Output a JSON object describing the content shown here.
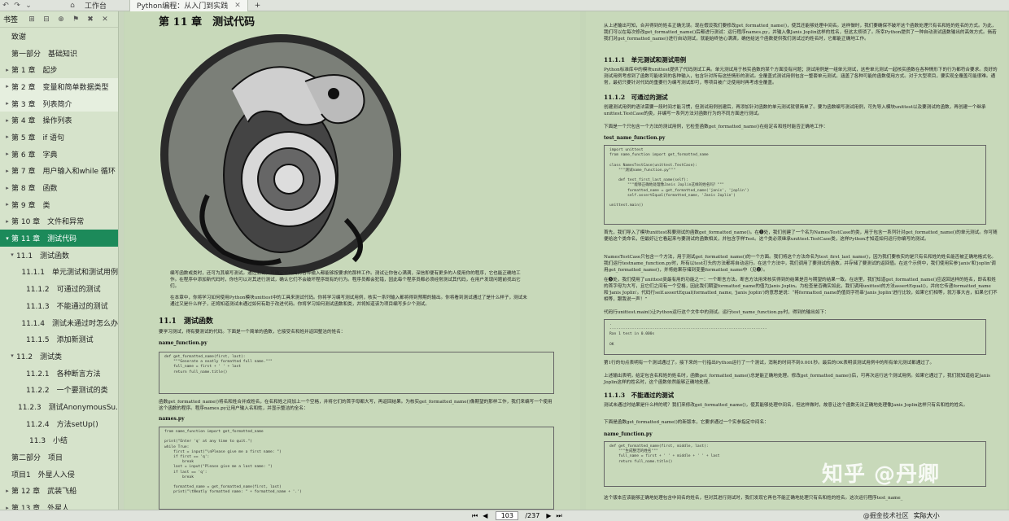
{
  "topbar": {
    "workspace_label": "工作台",
    "tab_title": "Python编程：从入门到实践",
    "add_tab": "+"
  },
  "sidebar": {
    "title": "书签",
    "items": [
      {
        "label": "致谢",
        "level": 0,
        "arrow": ""
      },
      {
        "label": "第一部分　基础知识",
        "level": 0,
        "arrow": ""
      },
      {
        "label": "第 1 章　起步",
        "level": 0,
        "arrow": "▸"
      },
      {
        "label": "第 2 章　变量和简单数据类型",
        "level": 0,
        "arrow": "▸"
      },
      {
        "label": "第 3 章　列表简介",
        "level": 0,
        "arrow": "▸"
      },
      {
        "label": "第 4 章　操作列表",
        "level": 0,
        "arrow": "▸"
      },
      {
        "label": "第 5 章　if 语句",
        "level": 0,
        "arrow": "▸"
      },
      {
        "label": "第 6 章　字典",
        "level": 0,
        "arrow": "▸"
      },
      {
        "label": "第 7 章　用户输入和while 循环",
        "level": 0,
        "arrow": "▸"
      },
      {
        "label": "第 8 章　函数",
        "level": 0,
        "arrow": "▸"
      },
      {
        "label": "第 9 章　类",
        "level": 0,
        "arrow": "▸"
      },
      {
        "label": "第 10 章　文件和异常",
        "level": 0,
        "arrow": "▸"
      },
      {
        "label": "第 11 章　测试代码",
        "level": 0,
        "arrow": "▾"
      },
      {
        "label": "11.1　测试函数",
        "level": 1,
        "arrow": "▾"
      },
      {
        "label": "11.1.1　单元测试和测试用例",
        "level": 2,
        "arrow": ""
      },
      {
        "label": "11.1.2　可通过的测试",
        "level": 2,
        "arrow": ""
      },
      {
        "label": "11.1.3　不能通过的测试",
        "level": 2,
        "arrow": ""
      },
      {
        "label": "11.1.4　测试未通过时怎么办",
        "level": 2,
        "arrow": ""
      },
      {
        "label": "11.1.5　添加新测试",
        "level": 2,
        "arrow": ""
      },
      {
        "label": "11.2　测试类",
        "level": 1,
        "arrow": "▾"
      },
      {
        "label": "11.2.1　各种断言方法",
        "level": 2,
        "arrow": ""
      },
      {
        "label": "11.2.2　一个要测试的类",
        "level": 2,
        "arrow": ""
      },
      {
        "label": "11.2.3　测试AnonymousSu...",
        "level": 2,
        "arrow": ""
      },
      {
        "label": "11.2.4　方法setUp()",
        "level": 2,
        "arrow": ""
      },
      {
        "label": "11.3　小结",
        "level": 3,
        "arrow": ""
      },
      {
        "label": "第二部分　项目",
        "level": 0,
        "arrow": ""
      },
      {
        "label": "项目1　外星人入侵",
        "level": 0,
        "arrow": ""
      },
      {
        "label": "第 12 章　武装飞船",
        "level": 0,
        "arrow": "▸"
      },
      {
        "label": "第 13 章　外星人",
        "level": 0,
        "arrow": "▸"
      }
    ]
  },
  "page_left": {
    "chapter_title": "第 11 章　测试代码",
    "intro_p1": "编写函数或类时，还可为其编写测试。通过测试，可确定代码面对各种输入都能够按要求的那样工作。测试让你信心满满，深信即便有更多的人使用你的程序，它也能正确地工作。在程序中添加新代码时，你也可以对其进行测试，确认它们不会破坏程序既有的行为。程序员都会犯错，因此每个程序员都必须经常测试其代码，在用户发现问题前找出它们。",
    "intro_p2": "在本章中，你将学习如何使用Python模块unittest中的工具来测试代码。你将学习编写测试用例，核实一系列输入都将得到预期的输出。你将看到测试通过了是什么样子，测试未通过又是什么样子，还将知道测试未通过如何有助于改进代码。你将学习如何测试函数和类，并将知道该为项目编写多少个测试。",
    "sec_title": "11.1　测试函数",
    "sec_text": "要学习测试，得有要测试的代码。下面是一个简单的函数，它接受名和姓并返回整洁的姓名：",
    "file1": "name_function.py",
    "code1": "def get_formatted_name(first, last):\n    \"\"\"Generate a neatly formatted full name.\"\"\"\n    full_name = first + ' ' + last\n    return full_name.title()",
    "para3": "函数get_formatted_name()将名和姓合并成姓名，在名和姓之间加上一个空格，并将它们的首字母都大写，再返回结果。为核实get_formatted_name()像期望的那样工作，我们来编写一个使用这个函数的程序。程序names.py让用户输入名和姓，并显示整洁的全名：",
    "file2": "names.py",
    "code2": "from name_function import get_formatted_name\n\nprint(\"Enter 'q' at any time to quit.\")\nwhile True:\n    first = input(\"\\nPlease give me a first name: \")\n    if first == 'q':\n        break\n    last = input(\"Please give me a last name: \")\n    if last == 'q':\n        break\n\n    formatted_name = get_formatted_name(first, last)\n    print(\"\\tNeatly formatted name: \" + formatted_name + '.')"
  },
  "page_right": {
    "p_top": "从上述输出可知，合并得到的姓名正确无误。现在假设我们要修改get_formatted_name()，使其还能够处理中间名。这样做时，我们要确保不破坏这个函数处理只有名和姓的姓名的方式。为此，我们可以在每次修改get_formatted_name()后都进行测试：运行程序names.py，并输入像Janis Joplin这样的姓名，但这太烦琐了。所幸Python提供了一种自动测试函数输出的高效方式。倘若我们对get_formatted_name()进行自动测试，就能始终信心满满，确信给这个函数提供我们测试过的姓名时，它都能正确地工作。",
    "h_1111": "11.1.1　单元测试和测试用例",
    "p_1111": "Python标准库中的模块unittest提供了代码测试工具。单元测试用于核实函数的某个方面没有问题；测试用例是一组单元测试，这些单元测试一起核实函数在各种情形下的行为都符合要求。良好的测试用例考虑到了函数可能收到的各种输入，包含针对所有这些情形的测试。全覆盖式测试用例包含一整套单元测试，涵盖了各种可能的函数使用方式。对于大型项目，要实现全覆盖可能很难。通常，最初只要针对代码的重要行为编写测试即可，等项目被广泛使用时再考虑全覆盖。",
    "h_1112": "11.1.2　可通过的测试",
    "p_1112a": "创建测试用例的语法需要一段时间才能习惯，但测试用例创建后，再添加针对函数的单元测试就很简单了。要为函数编写测试用例，可先导入模块unittest以及要测试的函数，再创建一个继承unittest.TestCase的类，并编写一系列方法对函数行为的不同方面进行测试。",
    "p_1112b": "下面是一个只包含一个方法的测试用例，它检查函数get_formatted_name()在给定名和姓时能否正确地工作：",
    "file3": "test_name_function.py",
    "code3": "import unittest\nfrom name_function import get_formatted_name\n\nclass NamesTestCase(unittest.TestCase):\n    \"\"\"测试name_function.py\"\"\"\n\n    def test_first_last_name(self):\n        \"\"\"能够正确地处理像Janis Joplin这样的姓名吗？\"\"\"\n        formatted_name = get_formatted_name('janis', 'joplin')\n        self.assertEqual(formatted_name, 'Janis Joplin')\n\nunittest.main()",
    "p_after1": "首先，我们导入了模块unittest和要测试的函数get_formatted_name()。在❶处，我们创建了一个名为NamesTestCase的类，用于包含一系列针对get_formatted_name()的单元测试。你可随便给这个类命名，但最好让它看起来与要测试的函数相关，并包含字样Test。这个类必须继承unittest.TestCase类，这样Python才知道如何运行你编写的测试。",
    "p_after2": "NamesTestCase只包含一个方法，用于测试get_formatted_name()的一个方面。我们将这个方法命名为test_first_last_name()，因为我们要核实的是只有名和姓的姓名能否被正确地格式化。我们运行testname_function.py时，所有以test打头的方法都将自动运行。在这个方法中，我们调用了要测试的函数，并存储了要测试的返回值。在这个示例中，我们使用实参'janis'和'joplin'调用get_formatted_name()，并将结果存储到变量formatted_name中（见❷）。",
    "p_after3": "在❸处，我们使用了unittest类最有用的功能之一：一个断言方法。断言方法用来核实得到的结果是否与期望的结果一致。在这里，我们知道get_formatted_name()应返回这样的姓名，即名和姓的首字母为大写，且它们之间有一个空格，因此我们期望formatted_name的值为Janis Joplin。为检查是否确实如此，我们调用unittest的方法assertEqual()，并向它传递formatted_name和'Janis Joplin'。代码行self.assertEqual(formatted_name, 'Janis Joplin')的意思是说：“将formatted_name的值同字符串'Janis Joplin'进行比较，如果它们相等，就万事大吉，如果它们不相等，跟我说一声！”",
    "p_run": "代码行unittest.main()让Python运行这个文件中的测试。运行test_name_function.py时，得到的输出如下：",
    "out1": ".\n----------------------------------------------------------------------\nRan 1 test in 0.000s\n\nOK",
    "p_out": "第1行的句点表明有一个测试通过了。接下来的一行指出Python运行了一个测试，消耗的时间不到0.001秒。最后的OK表明该测试用例中的所有单元测试都通过了。",
    "p_out2": "上述输出表明，给定包含名和姓的姓名时，函数get_formatted_name()总是能正确地处理。修改get_formatted_name()后，可再次运行这个测试用例。如果它通过了，我们就知道给定Janis Joplin这样的姓名时，这个函数依然能够正确地处理。",
    "h_1113": "11.1.3　不能通过的测试",
    "p_1113": "测试未通过时结果是什么样的呢？我们来修改get_formatted_name()，使其能够处理中间名，但这样做时，故意让这个函数无法正确地处理像Janis Joplin这样只有名和姓的姓名。",
    "p_1113b": "下面是函数get_formatted_name()的新版本，它要求通过一个实参指定中间名：",
    "file4": "name_function.py",
    "code4": "def get_formatted_name(first, middle, last):\n    \"\"\"生成整洁的姓名\"\"\"\n    full_name = first + ' ' + middle + ' ' + last\n    return full_name.title()",
    "p_bottom": "这个版本应该能够正确地处理包含中间名的姓名，但对其进行测试时，我们发现它再也不能正确地处理只有名和姓的姓名。这次运行程序test_name_"
  },
  "bottombar": {
    "current_page": "103",
    "total_pages": "/237",
    "fit_label": "实际大小"
  },
  "watermarks": {
    "zhihu": "知乎 @丹卿",
    "juejin": "@掘金技术社区"
  },
  "colors": {
    "page_bg": "#c8d9ba",
    "sidebar_selected": "#1c8a5a",
    "sidebar_bg": "#d6e3cb"
  }
}
